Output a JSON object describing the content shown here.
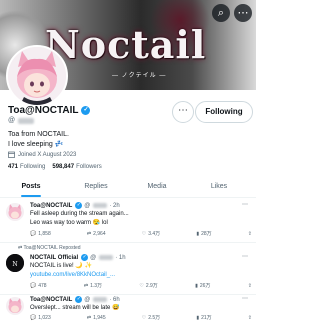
{
  "banner": {
    "title": "Noctail",
    "subtitle": "— ノクテイル —"
  },
  "top_buttons": {
    "search": "⌕",
    "more": "⋯"
  },
  "profile": {
    "name": "Toa@NOCTAIL",
    "handle_prefix": "@",
    "bio_line1": "Toa from NOCTAIL.",
    "bio_line2": "I love sleeping 💤",
    "joined": "Joined X August 2023",
    "following_count": "471",
    "following_label": "Following",
    "followers_count": "598,847",
    "followers_label": "Followers",
    "follow_button": "Following",
    "more_button": "⋯"
  },
  "tabs": [
    "Posts",
    "Replies",
    "Media",
    "Likes"
  ],
  "tweets": [
    {
      "name": "Toa@NOCTAIL",
      "handle": "@",
      "time": "· 2h",
      "line1": "Fell asleep during the stream again...",
      "line2": "Leo was way too warm 😪 lol",
      "replies": "1,858",
      "reposts": "2,964",
      "likes": "3.4万",
      "views": "28万"
    },
    {
      "repost_label": "Toa@NOCTAIL Reposted",
      "name": "NOCTAIL Official",
      "handle": "@",
      "time": "· 1h",
      "line1": "NOCTAIL is live! 🌙 ✨",
      "link": "youtube.com/live/8KkNOctail_...",
      "replies": "478",
      "reposts": "1.3万",
      "likes": "2.9万",
      "views": "26万"
    },
    {
      "name": "Toa@NOCTAIL",
      "handle": "@",
      "time": "· 6h",
      "line1": "Overslept... stream will be late 😅",
      "replies": "1,023",
      "reposts": "1,945",
      "likes": "2.5万",
      "views": "21万"
    }
  ]
}
